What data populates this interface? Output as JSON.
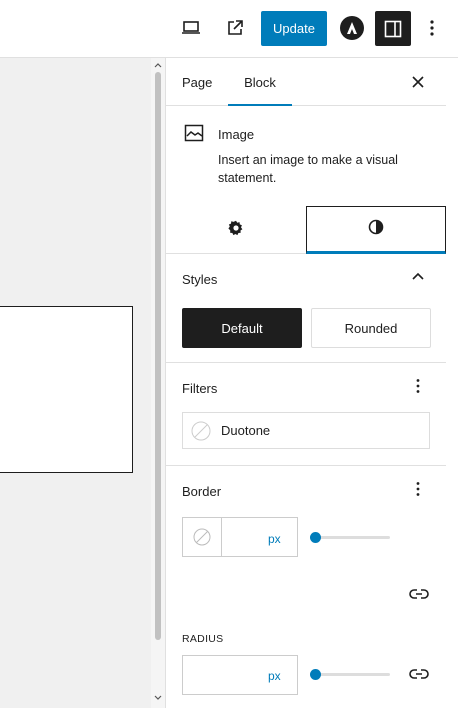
{
  "toolbar": {
    "update_label": "Update",
    "icons": [
      "desktop-preview-icon",
      "external-link-icon",
      "astra-logo-icon",
      "sidebar-toggle-icon",
      "more-vertical-icon"
    ]
  },
  "sidebar": {
    "tabs": {
      "page": "Page",
      "block": "Block"
    },
    "block_card": {
      "title": "Image",
      "description": "Insert an image to make a visual statement."
    },
    "styles_panel": {
      "title": "Styles",
      "default_label": "Default",
      "rounded_label": "Rounded"
    },
    "filters_panel": {
      "title": "Filters",
      "duotone_label": "Duotone"
    },
    "border_panel": {
      "title": "Border",
      "width_unit": "px",
      "radius_label": "RADIUS",
      "radius_unit": "px"
    }
  },
  "colors": {
    "accent": "#007cba",
    "dark": "#1e1e1e",
    "canvas_bg": "#f0f0f0"
  }
}
